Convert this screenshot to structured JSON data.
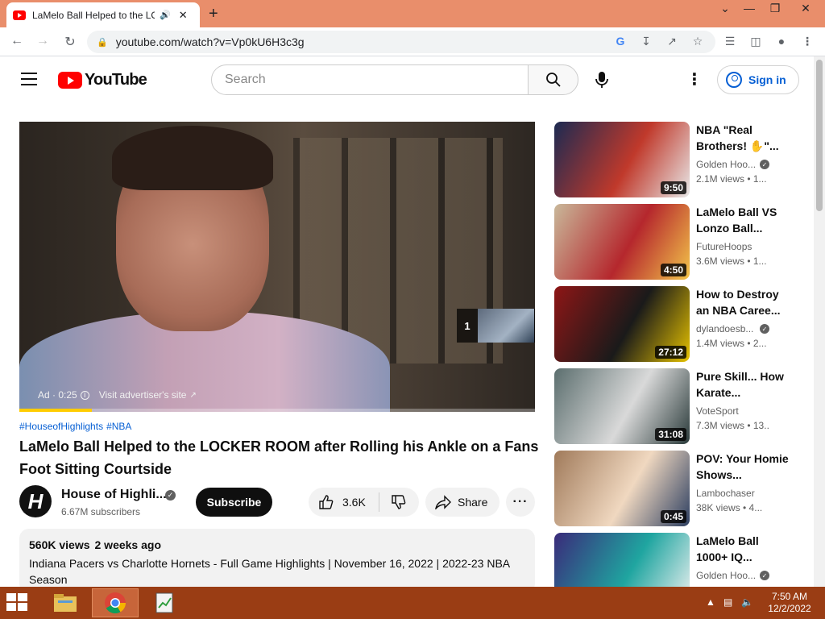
{
  "browser": {
    "tab_title": "LaMelo Ball Helped to the LOCKER ROOM after Rolling his Ankle on a Fans Foot Sitting Courtside",
    "url": "youtube.com/watch?v=Vp0kU6H3c3g",
    "icons": [
      "back-icon",
      "forward-icon",
      "reload-icon",
      "lock-icon",
      "google-icon",
      "install-icon",
      "share-icon",
      "star-icon",
      "media-icon",
      "sidepanel-icon",
      "profile-icon",
      "menu-icon"
    ]
  },
  "header": {
    "logo_text": "YouTube",
    "search_placeholder": "Search",
    "sign_in": "Sign in"
  },
  "player": {
    "ad_label": "Ad · 0:25",
    "visit_label": "Visit advertiser's site",
    "preview_count": "1",
    "progress_fraction": 0.14
  },
  "video": {
    "hashtags": [
      "#HouseofHighlights",
      "#NBA"
    ],
    "title": "LaMelo Ball Helped to the LOCKER ROOM after Rolling his Ankle on a Fans Foot Sitting Courtside",
    "channel": "House of Highli...",
    "channel_avatar_letter": "H",
    "subscribers": "6.67M subscribers",
    "subscribe_label": "Subscribe",
    "likes": "3.6K",
    "share_label": "Share",
    "views": "560K views",
    "age": "2 weeks ago",
    "description": "Indiana Pacers vs Charlotte Hornets - Full Game Highlights | November 16, 2022 | 2022-23 NBA Season"
  },
  "related": [
    {
      "title": "NBA \"Real Brothers! ✋\"...",
      "channel": "Golden Hoo...",
      "verified": true,
      "meta": "2.1M views • 1...",
      "duration": "9:50",
      "colors": [
        "#1c2a52",
        "#c0392b",
        "#e8e8e8"
      ]
    },
    {
      "title": "LaMelo Ball VS Lonzo Ball...",
      "channel": "FutureHoops",
      "verified": false,
      "meta": "3.6M views • 1...",
      "duration": "4:50",
      "colors": [
        "#c9b89a",
        "#b5272d",
        "#f3c54a"
      ]
    },
    {
      "title": "How to Destroy an NBA Caree...",
      "channel": "dylandoesb...",
      "verified": true,
      "meta": "1.4M views • 2...",
      "duration": "27:12",
      "colors": [
        "#8e1616",
        "#1a1a1a",
        "#e6c200"
      ]
    },
    {
      "title": "Pure Skill... How Karate...",
      "channel": "VoteSport",
      "verified": false,
      "meta": "7.3M views • 13...",
      "duration": "31:08",
      "colors": [
        "#5b6e6e",
        "#d9d9d9",
        "#2a3a3a"
      ]
    },
    {
      "title": "POV: Your Homie Shows...",
      "channel": "Lambochaser",
      "verified": false,
      "meta": "38K views • 4...",
      "duration": "0:45",
      "colors": [
        "#a07a5a",
        "#f0d8c0",
        "#2c3e60"
      ]
    },
    {
      "title": "LaMelo Ball 1000+ IQ...",
      "channel": "Golden Hoo...",
      "verified": true,
      "meta": "",
      "duration": "",
      "colors": [
        "#3a2a7a",
        "#1fa5a0",
        "#f2f2f2"
      ]
    }
  ],
  "taskbar": {
    "time": "7:50 AM",
    "date": "12/2/2022"
  }
}
